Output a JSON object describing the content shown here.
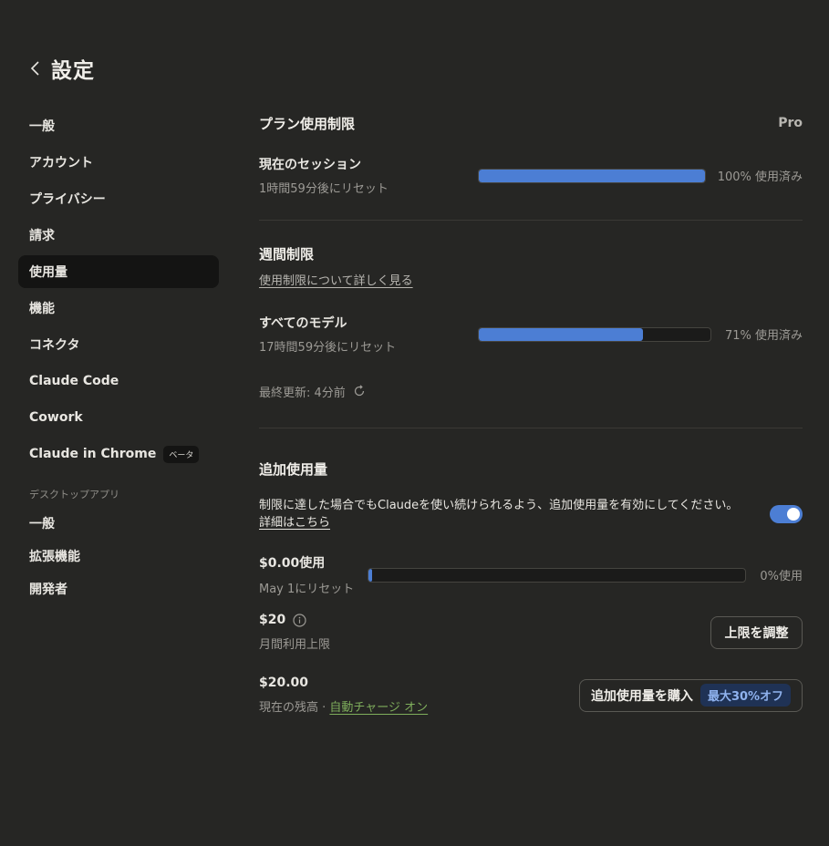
{
  "header": {
    "title": "設定"
  },
  "sidebar": {
    "items": [
      {
        "label": "一般"
      },
      {
        "label": "アカウント"
      },
      {
        "label": "プライバシー"
      },
      {
        "label": "請求"
      },
      {
        "label": "使用量"
      },
      {
        "label": "機能"
      },
      {
        "label": "コネクタ"
      },
      {
        "label": "Claude Code"
      },
      {
        "label": "Cowork"
      },
      {
        "label": "Claude in Chrome",
        "badge": "ベータ"
      }
    ],
    "desktop_section_label": "デスクトップアプリ",
    "desktop_items": [
      {
        "label": "一般"
      },
      {
        "label": "拡張機能"
      },
      {
        "label": "開発者"
      }
    ]
  },
  "plan": {
    "title": "プラン使用制限",
    "plan_name": "Pro",
    "session_label": "現在のセッション",
    "session_reset": "1時間59分後にリセット",
    "session_percent": 100,
    "session_percent_text": "100% 使用済み"
  },
  "weekly": {
    "title": "週間制限",
    "learn_more": "使用制限について詳しく見る",
    "all_models_label": "すべてのモデル",
    "all_models_reset": "17時間59分後にリセット",
    "all_models_percent": 71,
    "all_models_percent_text": "71% 使用済み",
    "last_updated": "最終更新: 4分前"
  },
  "extra": {
    "title": "追加使用量",
    "description": "制限に達した場合でもClaudeを使い続けられるよう、追加使用量を有効にしてください。",
    "details_link": "詳細はこちら",
    "toggle_on": true,
    "used_amount": "$0.00使用",
    "used_reset": "May 1にリセット",
    "used_percent": 1,
    "used_percent_text": "0%使用",
    "limit_amount": "$20",
    "limit_label": "月間利用上限",
    "adjust_button": "上限を調整",
    "balance_amount": "$20.00",
    "balance_label": "現在の残高 ·",
    "auto_charge": "自動チャージ オン",
    "buy_button": "追加使用量を購入",
    "discount_badge": "最大30%オフ"
  },
  "colors": {
    "accent": "#4c7ed4",
    "background": "#262624",
    "active_nav": "#141413",
    "green_link": "#7fae5c"
  }
}
